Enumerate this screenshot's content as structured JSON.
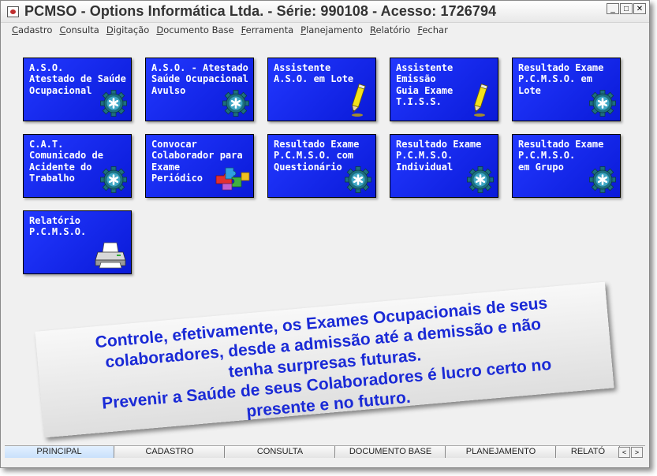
{
  "window": {
    "title": "PCMSO - Options Informática Ltda. - Série: 990108 - Acesso: 1726794",
    "minimize": "_",
    "maximize": "□",
    "close": "✕"
  },
  "menu": [
    {
      "first": "C",
      "rest": "adastro"
    },
    {
      "first": "C",
      "rest": "onsulta"
    },
    {
      "first": "D",
      "rest": "igitação"
    },
    {
      "first": "D",
      "rest": "ocumento Base"
    },
    {
      "first": "F",
      "rest": "erramenta"
    },
    {
      "first": "P",
      "rest": "lanejamento"
    },
    {
      "first": "R",
      "rest": "elatório"
    },
    {
      "first": "F",
      "rest": "echar"
    }
  ],
  "tiles": [
    {
      "label": "A.S.O.\nAtestado de Saúde\nOcupacional",
      "icon": "gear-icon"
    },
    {
      "label": "A.S.O. - Atestado\nSaúde Ocupacional\nAvulso",
      "icon": "gear-icon"
    },
    {
      "label": "Assistente\nA.S.O. em Lote",
      "icon": "pencil-icon"
    },
    {
      "label": "Assistente Emissão\nGuia Exame\nT.I.S.S.",
      "icon": "pencil-icon"
    },
    {
      "label": "Resultado Exame\nP.C.M.S.O. em Lote",
      "icon": "gear-icon"
    },
    {
      "label": "C.A.T.\nComunicado de\nAcidente do\nTrabalho",
      "icon": "gear-icon"
    },
    {
      "label": "Convocar\nColaborador para\nExame\nPeriódico",
      "icon": "puzzle-icon"
    },
    {
      "label": "Resultado Exame\nP.C.M.S.O. com\nQuestionário",
      "icon": "gear-icon"
    },
    {
      "label": "Resultado Exame\nP.C.M.S.O.\nIndividual",
      "icon": "gear-icon"
    },
    {
      "label": "Resultado Exame\nP.C.M.S.O.\nem Grupo",
      "icon": "gear-icon"
    },
    {
      "label": "Relatório\nP.C.M.S.O.",
      "icon": "printer-icon"
    }
  ],
  "banner": {
    "line1": "Controle, efetivamente, os Exames Ocupacionais de seus",
    "line2": "colaboradores, desde a admissão até a demissão e não",
    "line3": "tenha surpresas futuras.",
    "line4": "Prevenir a Saúde de seus Colaboradores é lucro certo no",
    "line5": "presente e no futuro."
  },
  "tabs": [
    "PRINCIPAL",
    "CADASTRO",
    "CONSULTA",
    "DOCUMENTO BASE",
    "PLANEJAMENTO",
    "RELATÓ"
  ],
  "tab_scroll": {
    "left": "<",
    "right": ">"
  },
  "colors": {
    "tile_blue": "#1428f0",
    "banner_text": "#1a2ad6"
  }
}
